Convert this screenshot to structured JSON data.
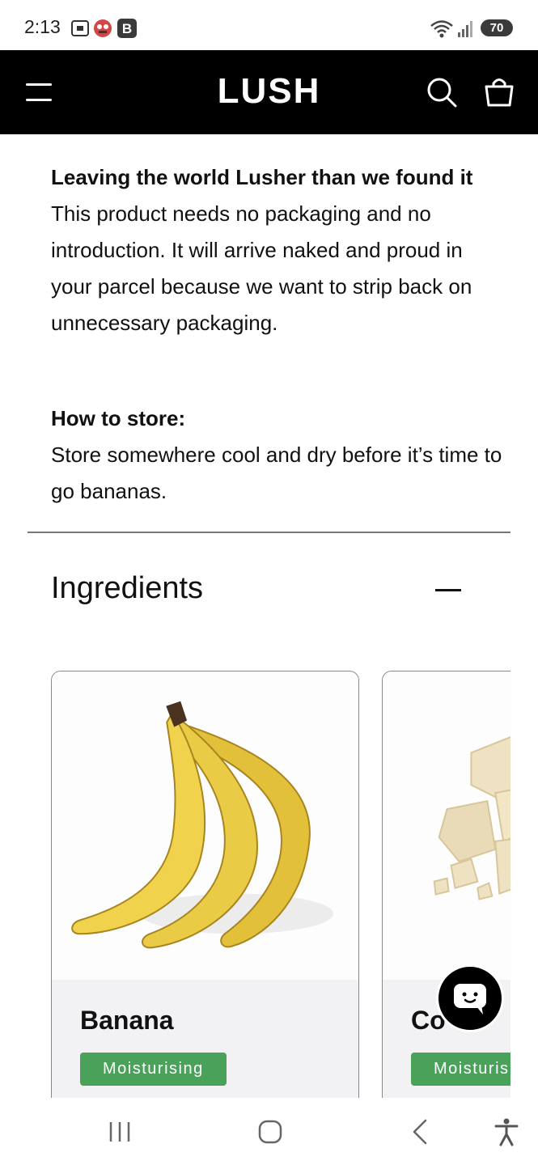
{
  "status_bar": {
    "time": "2:13",
    "battery": "70",
    "icons": [
      "screenshot-icon",
      "profile-icon",
      "b-app-icon",
      "wifi-icon",
      "signal-icon"
    ]
  },
  "header": {
    "logo": "LUSH",
    "menu_icon": "hamburger-menu-icon",
    "search_icon": "search-icon",
    "bag_icon": "shopping-bag-icon",
    "background": "#000000"
  },
  "packaging": {
    "heading": "Leaving the world Lusher than we found it",
    "body": "This product needs no packaging and no introduction. It will arrive naked and proud in your parcel because we want to strip back on unnecessary packaging."
  },
  "storage": {
    "heading": "How to store:",
    "body": "Store somewhere cool and dry before it’s time to go bananas."
  },
  "ingredients": {
    "title": "Ingredients",
    "collapse_icon": "minus-icon",
    "cards": [
      {
        "name": "Banana",
        "tag": "Moisturising",
        "image": "banana-image"
      },
      {
        "name": "Co",
        "tag": "Moisturis",
        "image": "cocoa-butter-image"
      }
    ],
    "tag_color": "#4aa25a"
  },
  "chat": {
    "icon": "chat-bubble-icon"
  },
  "nav_bar": {
    "buttons": [
      "recent-apps-icon",
      "home-icon",
      "back-icon",
      "accessibility-icon"
    ]
  }
}
